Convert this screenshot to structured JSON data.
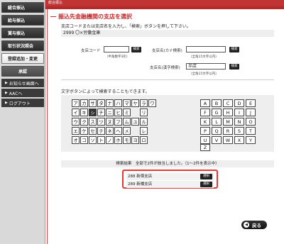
{
  "sidebar": {
    "items": [
      {
        "label": "総合振込",
        "active": false
      },
      {
        "label": "給与振込",
        "active": false
      },
      {
        "label": "賞与振込",
        "active": false
      },
      {
        "label": "取引状況照会",
        "active": false
      },
      {
        "label": "登録追加・変更",
        "active": true
      },
      {
        "label": "承認",
        "active": false
      }
    ],
    "links": [
      {
        "label": "お知らせ画面へ"
      },
      {
        "label": "AACへ"
      },
      {
        "label": "ログアウト"
      }
    ]
  },
  "header": {
    "topbar": "総合振込"
  },
  "main": {
    "title": "振込先金融機関の支店を選択",
    "instruction": "支店コードまたは支店名を入力し、「検索」ボタンを押して下さい。",
    "bank": "2999 〇×労働金庫"
  },
  "search": {
    "branch_code_label": "支店コード",
    "branch_code_hint": "（半角数字3桁）",
    "branch_code_value": "",
    "kana_label": "支店名(カナ検索)",
    "kana_hint": "（全角15文字以内）",
    "kana_value": "",
    "kanji_label": "支店名(漢字検索)",
    "kanji_hint": "（全角15文字以内）",
    "kanji_value": "半店",
    "search_label": "検索"
  },
  "kana": {
    "heading": "文字ボタンによって検索することもできます。",
    "rows": [
      [
        "ア",
        "カ",
        "サ",
        "タ",
        "ナ",
        "ハ",
        "マ",
        "ヤ",
        "ラ",
        "ワ"
      ],
      [
        "イ",
        "キ",
        "シ",
        "チ",
        "ニ",
        "ヒ",
        "ミ",
        "",
        "リ",
        ""
      ],
      [
        "ウ",
        "ク",
        "ス",
        "ツ",
        "ヌ",
        "フ",
        "ム",
        "ユ",
        "ル",
        ""
      ],
      [
        "エ",
        "ケ",
        "セ",
        "テ",
        "ネ",
        "ヘ",
        "メ",
        "",
        "レ",
        ""
      ],
      [
        "オ",
        "コ",
        "ソ",
        "ト",
        "ノ",
        "ホ",
        "モ",
        "ヨ",
        "ロ",
        ""
      ]
    ],
    "selected": "シ",
    "alpha": [
      [
        "A",
        "B",
        "C",
        "D",
        "E"
      ],
      [
        "F",
        "G",
        "H",
        "I",
        "J"
      ],
      [
        "K",
        "L",
        "M",
        "N",
        "O"
      ],
      [
        "P",
        "Q",
        "R",
        "S",
        "T"
      ],
      [
        "U",
        "V",
        "W",
        "X",
        "Y"
      ],
      [
        "Z"
      ]
    ]
  },
  "results": {
    "summary": "検索結果　全部で2件が該当しました。（1～2件を表示中）",
    "items": [
      {
        "code": "288",
        "name": "新宿支店",
        "action": "選択"
      },
      {
        "code": "289",
        "name": "新橋支店",
        "action": "選択"
      }
    ]
  },
  "footer": {
    "back_label": "戻る",
    "back_icon": "◀"
  },
  "colors": {
    "accent": "#c62828",
    "highlight": "#e53935",
    "nav_dark": "#2b2b2b"
  }
}
